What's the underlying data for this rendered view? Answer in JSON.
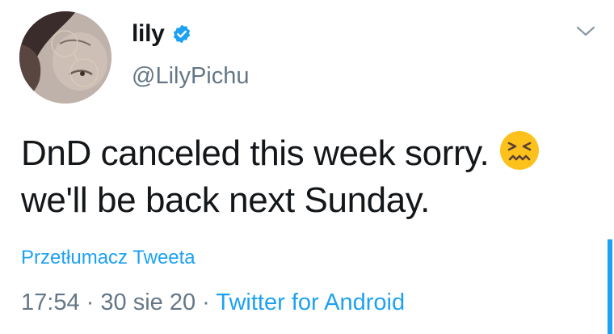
{
  "tweet": {
    "author": {
      "display_name": "lily",
      "handle": "@LilyPichu",
      "verified": true
    },
    "text_lines": [
      "DnD canceled this week sorry.",
      "we'll be back next Sunday."
    ],
    "emoji": "confounded-face-icon",
    "translate_label": "Przetłumacz Tweeta",
    "time": "17:54",
    "separator": "·",
    "date": "30 sie 20",
    "source": "Twitter for Android"
  },
  "colors": {
    "link_blue": "#1da1f2",
    "text_primary": "#14171a",
    "text_secondary": "#657786"
  }
}
